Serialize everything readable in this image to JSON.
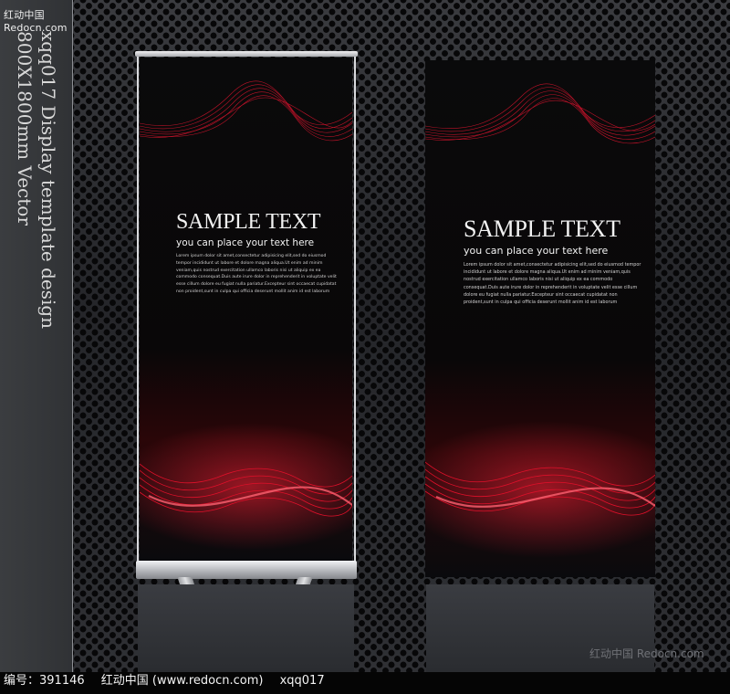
{
  "watermarks": {
    "top": "红动中国 Redocn.com",
    "bottom": "红动中国 Redocn.com"
  },
  "side_caption": {
    "line1": "xqq017 Display template design",
    "line2": "800X1800mm Vector"
  },
  "banners": [
    {
      "headline": "SAMPLE TEXT",
      "subline": "you can place your text here",
      "body": "Lorem ipsum dolor sit amet,consectetur adipisicing elit,sed do eiusmod tempor incididunt ut labore et dolore magna aliqua.Ut enim ad minim veniam,quis nostrud exercitation ullamco laboris nisi ut aliquip ex ea commodo consequat.Duis aute irure dolor in reprehenderit in voluptate velit esse cillum dolore eu fugiat nulla pariatur.Excepteur sint occaecat cupidatat non proident,sunt in culpa qui officia deserunt mollit anim id est laborum"
    },
    {
      "headline": "SAMPLE TEXT",
      "subline": "you can place your text here",
      "body": "Lorem ipsum dolor sit amet,consectetur adipisicing elit,sed do eiusmod tempor incididunt ut labore et dolore magna aliqua.Ut enim ad minim veniam,quis nostrud exercitation ullamco laboris nisi ut aliquip ex ea commodo consequat.Duis aute irure dolor in reprehenderit in voluptate velit esse cillum dolore eu fugiat nulla pariatur.Excepteur sint occaecat cupidatat non proident,sunt in culpa qui officia deserunt mollit anim id est laborum"
    }
  ],
  "footer": {
    "id_label": "编号：391146",
    "site": "红动中国 (www.redocn.com)",
    "code": "xqq017"
  },
  "colors": {
    "accent_red": "#e0102a",
    "background_metal": "#2a2b2e",
    "banner_black": "#0a0a0b"
  }
}
